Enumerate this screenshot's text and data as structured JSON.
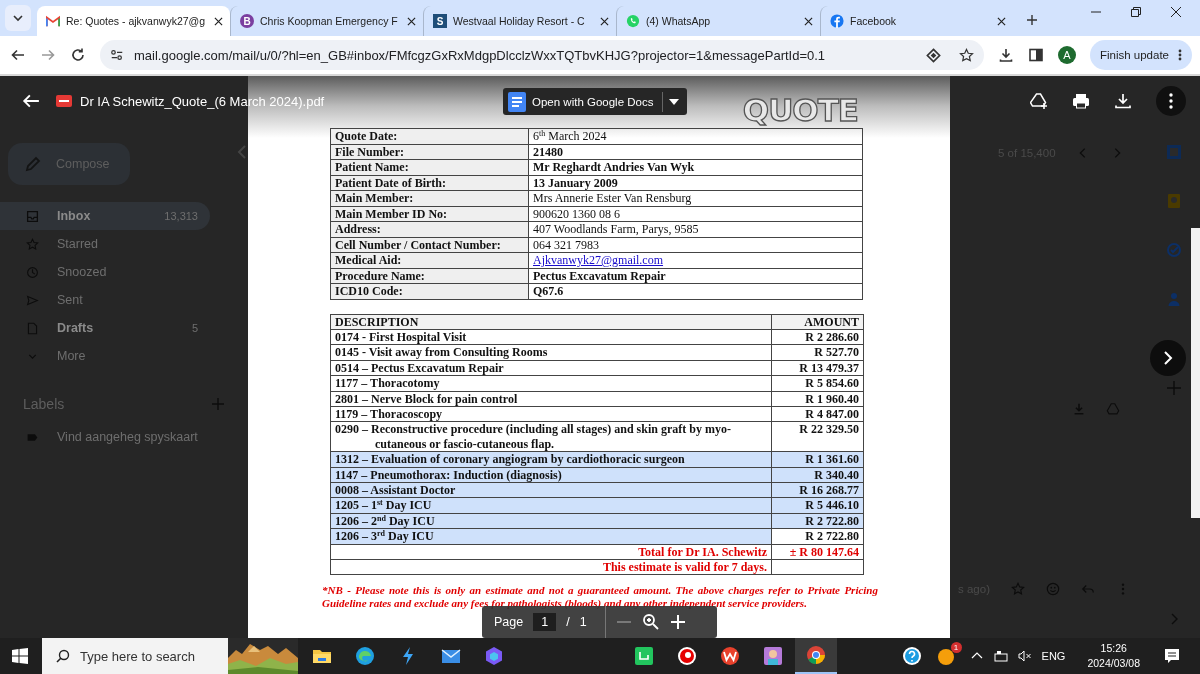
{
  "browser": {
    "tabs": [
      {
        "title": "Re: Quotes - ajkvanwyk27@g",
        "kind": "gmail",
        "selected": true
      },
      {
        "title": "Chris Koopman Emergency F",
        "kind": "letter",
        "favicon_text": "B",
        "color": "#7b3fa0",
        "selected": false
      },
      {
        "title": "Westvaal Holiday Resort - C",
        "kind": "letter",
        "favicon_text": "S",
        "color": "#1f4e79",
        "selected": false
      },
      {
        "title": "(4) WhatsApp",
        "kind": "whatsapp",
        "selected": false
      },
      {
        "title": "Facebook",
        "kind": "facebook",
        "selected": false
      }
    ],
    "url": "mail.google.com/mail/u/0/?hl=en_GB#inbox/FMfcgzGxRxMdgpDlcclzWxxTQTbvKHJG?projector=1&messagePartId=0.1",
    "avatar": "A",
    "update_button": "Finish update"
  },
  "gmail": {
    "compose": "Compose",
    "nav": [
      {
        "label": "Inbox",
        "count": "13,313",
        "kind": "inbox",
        "bold": true,
        "selected": true
      },
      {
        "label": "Starred",
        "kind": "star",
        "bold": false,
        "selected": false
      },
      {
        "label": "Snoozed",
        "kind": "clock",
        "bold": false,
        "selected": false
      },
      {
        "label": "Sent",
        "kind": "send",
        "bold": false,
        "selected": false
      },
      {
        "label": "Drafts",
        "count": "5",
        "kind": "draft",
        "bold": true,
        "selected": false
      },
      {
        "label": "More",
        "kind": "chevron",
        "bold": false,
        "selected": false
      }
    ],
    "labels_heading": "Labels",
    "labels": [
      "Vind aangeheg spyskaart"
    ],
    "counter": "5 of 15,400",
    "time_fragment": "s ago)"
  },
  "viewer": {
    "file_name": "Dr IA Schewitz_Quote_(6 March 2024).pdf",
    "docs_button": "Open with Google Docs",
    "page_label": "Page",
    "page_current": "1",
    "page_separator": "/",
    "page_total": "1"
  },
  "document": {
    "title": "QUOTE",
    "details": [
      {
        "label": "Quote Date:",
        "value": "6$^{th}$ March 2024",
        "kind": "text",
        "bold": false
      },
      {
        "label": "File Number:",
        "value": "21480",
        "kind": "text",
        "bold": true
      },
      {
        "label": "Patient Name:",
        "value": "Mr Reghardt Andries Van Wyk",
        "kind": "text",
        "bold": true
      },
      {
        "label": "Patient Date of Birth:",
        "value": "13 January 2009",
        "kind": "text",
        "bold": true
      },
      {
        "label": "Main Member:",
        "value": "Mrs Annerie Ester Van Rensburg",
        "kind": "text",
        "bold": false
      },
      {
        "label": "Main Member ID No:",
        "value": "900620 1360 08 6",
        "kind": "text",
        "bold": false
      },
      {
        "label": "Address:",
        "value": "407 Woodlands Farm, Parys, 9585",
        "kind": "text",
        "bold": false
      },
      {
        "label": "Cell Number / Contact Number:",
        "value": "064 321 7983",
        "kind": "text",
        "bold": false
      },
      {
        "label": "Medical Aid:",
        "value": "Ajkvanwyk27@gmail.com",
        "kind": "link",
        "bold": false
      },
      {
        "label": "Procedure Name:",
        "value": "Pectus Excavatum Repair",
        "kind": "text",
        "bold": true
      },
      {
        "label": "ICD10 Code:",
        "value": "Q67.6",
        "kind": "text",
        "bold": true
      }
    ],
    "columns": [
      "DESCRIPTION",
      "AMOUNT"
    ],
    "items": [
      {
        "description": "0174 - First Hospital Visit",
        "amount": "R 2 286.60",
        "selected": false,
        "amount_selected": false
      },
      {
        "description": "0145 - Visit away from Consulting Rooms",
        "amount": "R 527.70",
        "selected": false,
        "amount_selected": false
      },
      {
        "description": "0514 – Pectus Excavatum Repair",
        "amount": "R 13 479.37",
        "selected": false,
        "amount_selected": false
      },
      {
        "description": "1177 – Thoracotomy",
        "amount": "R 5 854.60",
        "selected": false,
        "amount_selected": false
      },
      {
        "description": "2801 – Nerve Block for pain control",
        "amount": "R 1 960.40",
        "selected": false,
        "amount_selected": false
      },
      {
        "description": "1179 – Thoracoscopy",
        "amount": "R 4 847.00",
        "selected": false,
        "amount_selected": false
      },
      {
        "description": "0290 – Reconstructive procedure (including all stages) and skin graft by myo-cutaneous or fascio-cutaneous flap.",
        "amount": "R 22 329.50",
        "selected": false,
        "amount_selected": false
      },
      {
        "description": "1312 – Evaluation of coronary angiogram by cardiothoracic surgeon",
        "amount": "R 1 361.60",
        "selected": true,
        "amount_selected": true
      },
      {
        "description": "1147 – Pneumothorax: Induction (diagnosis)",
        "amount": "R 340.40",
        "selected": true,
        "amount_selected": true
      },
      {
        "description": "0008 – Assistant Doctor",
        "amount": "R 16 268.77",
        "selected": true,
        "amount_selected": true
      },
      {
        "description": "1205 – 1$^{st}$ Day ICU",
        "amount": "R 5 446.10",
        "selected": true,
        "amount_selected": true
      },
      {
        "description": "1206 – 2$^{nd}$ Day ICU",
        "amount": "R 2 722.80",
        "selected": true,
        "amount_selected": true
      },
      {
        "description": "1206 – 3$^{rd}$ Day ICU",
        "amount": "R 2 722.80",
        "selected": true,
        "amount_selected": false
      }
    ],
    "total_label": "Total for Dr IA. Schewitz",
    "total": "± R 80 147.64",
    "validity": "This estimate is valid for 7 days.",
    "note": "*NB - Please note this is only an estimate and not a guaranteed amount. The above charges refer to Private Pricing Guideline rates and exclude any fees for pathologists (bloods) and any other independent service providers."
  },
  "taskbar": {
    "search_placeholder": "Type here to search",
    "badge": "1",
    "language": "ENG",
    "time": "15:26",
    "date": "2024/03/08"
  }
}
